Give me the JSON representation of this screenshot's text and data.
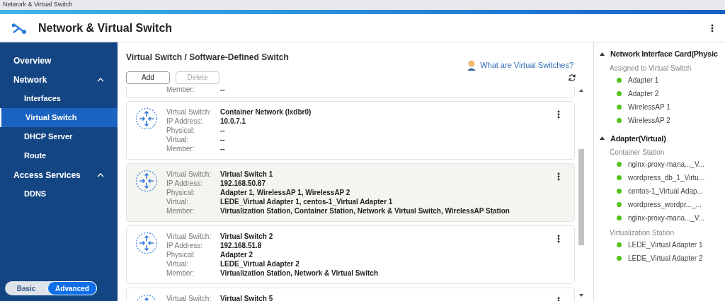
{
  "window": {
    "title": "Network & Virtual Switch"
  },
  "app": {
    "title": "Network & Virtual Switch"
  },
  "sidebar": {
    "items": [
      {
        "label": "Overview",
        "kind": "top",
        "selected": false
      },
      {
        "label": "Network",
        "kind": "group",
        "expanded": true,
        "children": [
          {
            "label": "Interfaces",
            "selected": false
          },
          {
            "label": "Virtual Switch",
            "selected": true
          },
          {
            "label": "DHCP Server",
            "selected": false
          },
          {
            "label": "Route",
            "selected": false
          }
        ]
      },
      {
        "label": "Access Services",
        "kind": "group",
        "expanded": true,
        "children": [
          {
            "label": "DDNS",
            "selected": false
          }
        ]
      }
    ],
    "mode_toggle": [
      {
        "label": "Basic",
        "selected": false
      },
      {
        "label": "Advanced",
        "selected": true
      }
    ]
  },
  "main": {
    "title": "Virtual Switch / Software-Defined Switch",
    "help_link": "What are Virtual Switches?",
    "buttons": [
      {
        "label": "Add",
        "disabled": false
      },
      {
        "label": "Delete",
        "disabled": true
      }
    ],
    "switches": [
      {
        "partial": true,
        "highlighted": false,
        "fields": [
          {
            "label": "Member:",
            "value": "--"
          }
        ]
      },
      {
        "partial": false,
        "highlighted": false,
        "fields": [
          {
            "label": "Virtual Switch:",
            "value": "Container Network (lxdbr0)"
          },
          {
            "label": "IP Address:",
            "value": "10.0.7.1"
          },
          {
            "label": "Physical:",
            "value": "--"
          },
          {
            "label": "Virtual:",
            "value": "--"
          },
          {
            "label": "Member:",
            "value": "--"
          }
        ]
      },
      {
        "partial": false,
        "highlighted": true,
        "fields": [
          {
            "label": "Virtual Switch:",
            "value": "Virtual Switch 1"
          },
          {
            "label": "IP Address:",
            "value": "192.168.50.87"
          },
          {
            "label": "Physical:",
            "value": "Adapter 1, WirelessAP 1, WirelessAP 2"
          },
          {
            "label": "Virtual:",
            "value": "LEDE_Virtual Adapter 1, centos-1_Virtual Adapter 1"
          },
          {
            "label": "Member:",
            "value": "Virtualization Station, Container Station, Network & Virtual Switch, WirelessAP Station"
          }
        ]
      },
      {
        "partial": false,
        "highlighted": false,
        "fields": [
          {
            "label": "Virtual Switch:",
            "value": "Virtual Switch 2"
          },
          {
            "label": "IP Address:",
            "value": "192.168.51.8"
          },
          {
            "label": "Physical:",
            "value": "Adapter 2"
          },
          {
            "label": "Virtual:",
            "value": "LEDE_Virtual Adapter 2"
          },
          {
            "label": "Member:",
            "value": "Virtualization Station, Network & Virtual Switch"
          }
        ]
      },
      {
        "partial": false,
        "highlighted": false,
        "fields": [
          {
            "label": "Virtual Switch:",
            "value": "Virtual Switch 5"
          }
        ]
      }
    ]
  },
  "side_panel": {
    "sections": [
      {
        "title": "Network Interface Card(Physic",
        "expanded": true,
        "groups": [
          {
            "title": "Assigned to Virtual Switch",
            "items": [
              {
                "label": "Adapter 1",
                "color": "#52c41a"
              },
              {
                "label": "Adapter 2",
                "color": "#52c41a"
              },
              {
                "label": "WirelessAP 1",
                "color": "#52c41a"
              },
              {
                "label": "WirelessAP 2",
                "color": "#52c41a"
              }
            ]
          }
        ]
      },
      {
        "title": "Adapter(Virtual)",
        "expanded": true,
        "groups": [
          {
            "title": "Container Station",
            "items": [
              {
                "label": "nginx-proxy-mana..._V...",
                "color": "#52c41a"
              },
              {
                "label": "wordpress_db_1_Virtu...",
                "color": "#52c41a"
              },
              {
                "label": "centos-1_Virtual Adap...",
                "color": "#52c41a"
              },
              {
                "label": "wordpress_wordpr..._...",
                "color": "#52c41a"
              },
              {
                "label": "nginx-proxy-mana..._V...",
                "color": "#52c41a"
              }
            ]
          },
          {
            "title": "Virtualization Station",
            "items": [
              {
                "label": "LEDE_Virtual Adapter 1",
                "color": "#52c41a"
              },
              {
                "label": "LEDE_Virtual Adapter 2",
                "color": "#52c41a"
              }
            ]
          }
        ]
      }
    ]
  }
}
